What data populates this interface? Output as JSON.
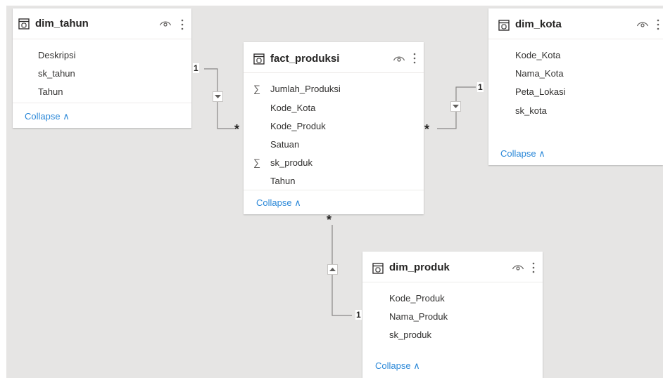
{
  "tables": {
    "dim_tahun": {
      "title": "dim_tahun",
      "fields": [
        "Deskripsi",
        "sk_tahun",
        "Tahun"
      ],
      "collapse_label": "Collapse"
    },
    "fact_produksi": {
      "title": "fact_produksi",
      "fields": [
        {
          "name": "Jumlah_Produksi",
          "sigma": true
        },
        {
          "name": "Kode_Kota",
          "sigma": false
        },
        {
          "name": "Kode_Produk",
          "sigma": false
        },
        {
          "name": "Satuan",
          "sigma": false
        },
        {
          "name": "sk_produk",
          "sigma": true
        },
        {
          "name": "Tahun",
          "sigma": false
        }
      ],
      "collapse_label": "Collapse"
    },
    "dim_kota": {
      "title": "dim_kota",
      "fields": [
        "Kode_Kota",
        "Nama_Kota",
        "Peta_Lokasi",
        "sk_kota"
      ],
      "collapse_label": "Collapse"
    },
    "dim_produk": {
      "title": "dim_produk",
      "fields": [
        "Kode_Produk",
        "Nama_Produk",
        "sk_produk"
      ],
      "collapse_label": "Collapse"
    }
  },
  "relationships": {
    "tahun_to_fact": {
      "one": "1",
      "many": "*"
    },
    "kota_to_fact": {
      "one": "1",
      "many": "*"
    },
    "produk_to_fact": {
      "one": "1",
      "many": "*"
    }
  },
  "icons": {
    "table": "table-icon",
    "visibility": "eye-icon",
    "more": "more-options-icon",
    "sigma": "∑",
    "collapse_chevron": "∧"
  },
  "colors": {
    "canvas_bg": "#e6e5e4",
    "card_bg": "#ffffff",
    "link": "#2b88d8",
    "text": "#252423",
    "wire": "#8a8886"
  }
}
